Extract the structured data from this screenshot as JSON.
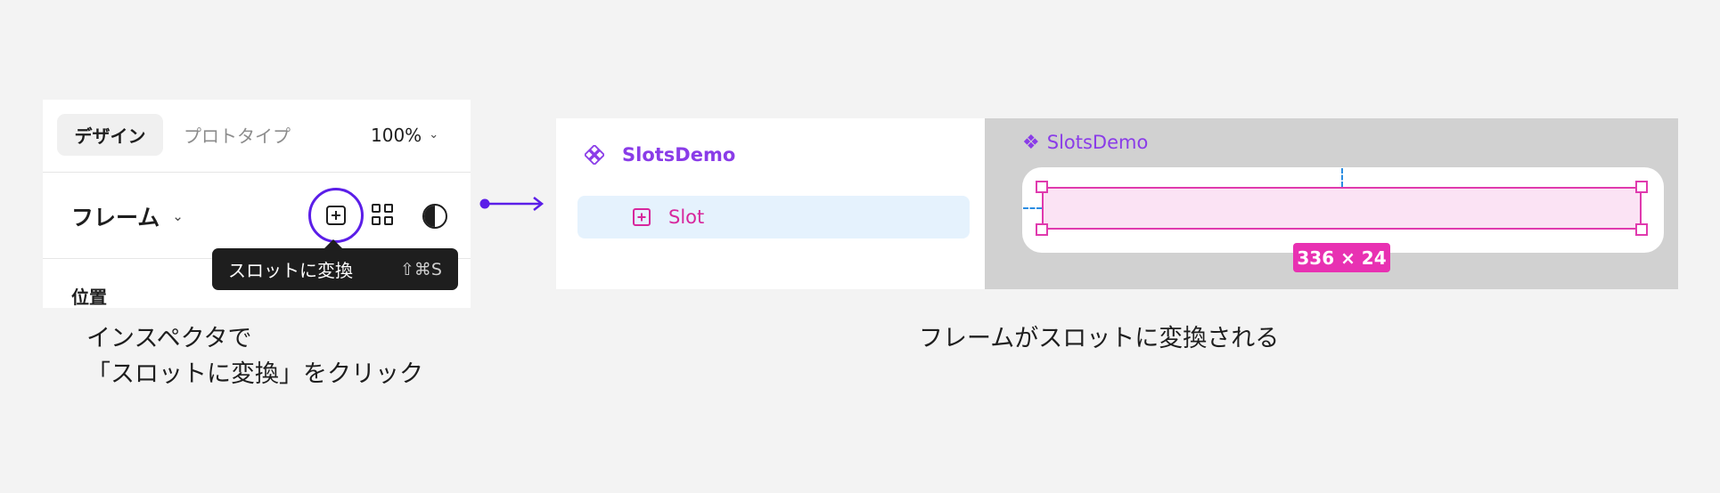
{
  "inspector": {
    "tabs": {
      "design": "デザイン",
      "prototype": "プロトタイプ"
    },
    "zoom": "100%",
    "frame_label": "フレーム",
    "tooltip": {
      "label": "スロットに変換",
      "shortcut": "⇧⌘S"
    },
    "position_label": "位置",
    "icons": [
      "convert-to-slot-icon",
      "component-grid-icon",
      "contrast-icon",
      "chevron-down-icon"
    ]
  },
  "captions": {
    "left": "インスペクタで\n「スロットに変換」をクリック",
    "right": "フレームがスロットに変換される"
  },
  "layers": {
    "component_name": "SlotsDemo",
    "slot_name": "Slot"
  },
  "canvas": {
    "component_name": "SlotsDemo",
    "dimensions": "336 × 24"
  },
  "colors": {
    "highlight_ring": "#5b1ee8",
    "component_purple": "#8a3ce8",
    "slot_pink": "#e03aae",
    "selected_row": "#e5f2fd"
  }
}
